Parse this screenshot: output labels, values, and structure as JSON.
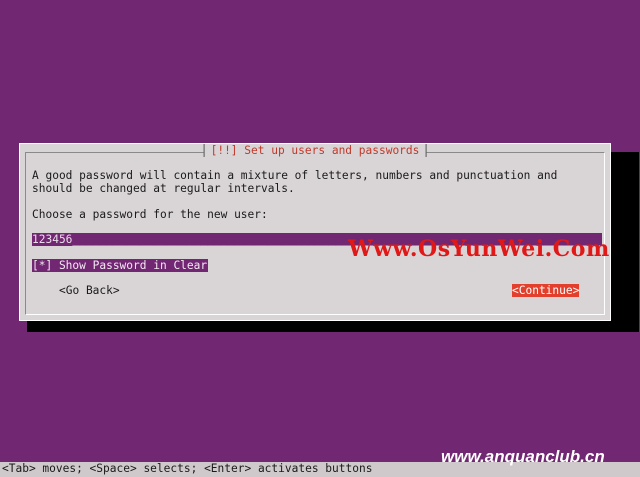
{
  "dialog": {
    "title": "[!!] Set up users and passwords",
    "message": "A good password will contain a mixture of letters, numbers and punctuation and should be changed at regular intervals.",
    "prompt": "Choose a password for the new user:",
    "password_value": "123456_______________________________________________________________________________",
    "show_password_label": "[*] Show Password in Clear",
    "go_back_label": "<Go Back>",
    "continue_label": "<Continue>"
  },
  "statusbar": {
    "text": "<Tab> moves; <Space> selects; <Enter> activates buttons"
  },
  "watermarks": {
    "center": "Www.OsYunWei.Com",
    "bottom_right": "www.anquanclub.cn"
  },
  "colors": {
    "desktop_background": "#712772",
    "dialog_background": "#d9d5d6",
    "title_text": "#c0392b",
    "selected_button": "#e2402c",
    "field_highlight": "#712772",
    "watermark_red": "#e01818"
  }
}
